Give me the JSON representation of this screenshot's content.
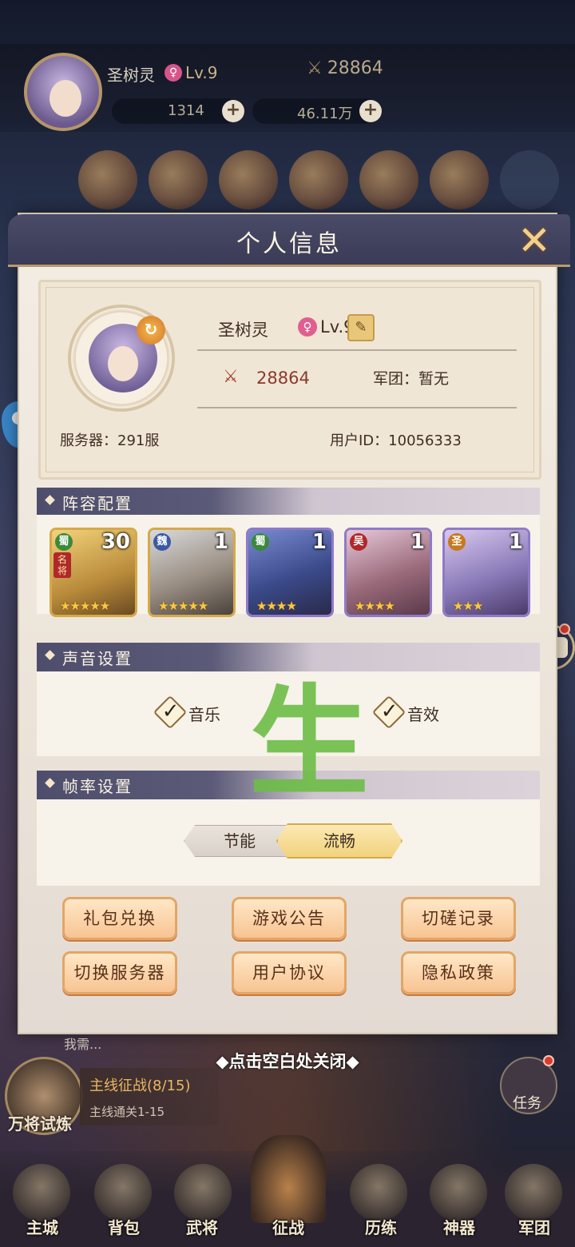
{
  "hud": {
    "player_name": "圣树灵",
    "gender_symbol": "♀",
    "level": "Lv.9",
    "power": "28864",
    "gold": "1314",
    "silver": "46.11万"
  },
  "modal": {
    "title": "个人信息",
    "close_symbol": "✕",
    "profile": {
      "name": "圣树灵",
      "gender_symbol": "♀",
      "level": "Lv.9",
      "edit_symbol": "✎",
      "power": "28864",
      "legion": "军团：暂无",
      "server": "服务器：291服",
      "user_id": "用户ID：10056333"
    },
    "lineup": {
      "title": "阵容配置",
      "heroes": [
        {
          "faction": "蜀",
          "level": "30",
          "tag": "名将",
          "stars": "★★★★★",
          "faction_color": "#3a8a3a"
        },
        {
          "faction": "魏",
          "level": "1",
          "tag": "",
          "stars": "★★★★★",
          "faction_color": "#3a5aa8"
        },
        {
          "faction": "蜀",
          "level": "1",
          "tag": "",
          "stars": "★★★★",
          "faction_color": "#3a8a3a"
        },
        {
          "faction": "吴",
          "level": "1",
          "tag": "",
          "stars": "★★★★",
          "faction_color": "#b0282a"
        },
        {
          "faction": "圣",
          "level": "1",
          "tag": "",
          "stars": "★★★",
          "faction_color": "#c8781e"
        }
      ]
    },
    "sound": {
      "title": "声音设置",
      "music_label": "音乐",
      "sfx_label": "音效",
      "check_symbol": "✓"
    },
    "fps": {
      "title": "帧率设置",
      "option_low": "节能",
      "option_high": "流畅",
      "selected": "流畅"
    },
    "buttons": {
      "gift_code": "礼包兑换",
      "announcement": "游戏公告",
      "duel_record": "切磋记录",
      "switch_server": "切换服务器",
      "user_agreement": "用户协议",
      "privacy_policy": "隐私政策"
    },
    "close_hint": "◆点击空白处关闭◆"
  },
  "watermark": "生",
  "bottom": {
    "chat_preview": "我需...",
    "trial_label": "万将试炼",
    "quest_title": "主线征战(8/15)",
    "quest_sub": "主线通关1-15",
    "task_label": "任务",
    "nav": [
      "主城",
      "背包",
      "武将",
      "征战",
      "历练",
      "神器",
      "军团"
    ]
  },
  "colors": {
    "accent_gold": "#d4a94a",
    "header_purple": "#4a4b68",
    "power_red": "#8a3a2a",
    "button_peach": "#f7c493"
  }
}
